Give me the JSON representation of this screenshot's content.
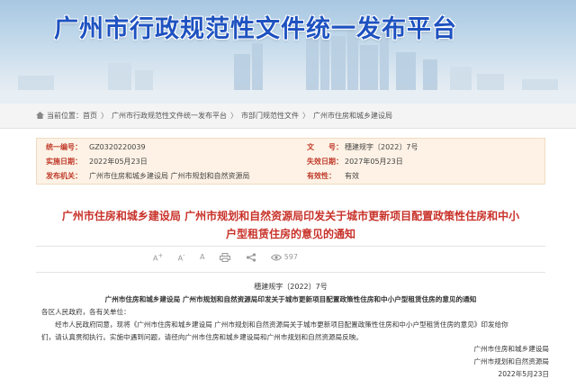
{
  "banner": {
    "title": "广州市行政规范性文件统一发布平台"
  },
  "breadcrumb": {
    "prefix": "当前位置：",
    "items": [
      "首页",
      "广州市行政规范性文件统一发布平台",
      "市部门规范性文件",
      "广州市住房和城乡建设局"
    ]
  },
  "meta": {
    "uid_label": "统一编号：",
    "uid_value": "GZ0320220039",
    "doc_label": "文　　号：",
    "doc_value": "穗建规字〔2022〕7号",
    "effective_label": "实施日期：",
    "effective_value": "2022年05月23日",
    "expire_label": "失效日期：",
    "expire_value": "2027年05月23日",
    "issuer_label": "发布机关：",
    "issuer_value": "广州市住房和城乡建设局 广州市规划和自然资源局",
    "status_label": "有效性：",
    "status_value": "有效"
  },
  "document": {
    "title_line1": "广州市住房和城乡建设局 广州市规划和自然资源局印发关于城市更新项目配置政策性住房和中小",
    "title_line2": "户型租赁住房的意见的通知",
    "views": "597",
    "doc_no": "穗建规字〔2022〕7号",
    "sub_title": "广州市住房和城乡建设局 广州市规划和自然资源局印发关于城市更新项目配置政策性住房和中小户型租赁住房的意见的通知",
    "salutation": "各区人民政府，各有关单位：",
    "body_line1": "　　经市人民政府同意，现将《广州市住房和城乡建设局 广州市规划和自然资源局关于城市更新项目配置政策性住房和中小户型租赁住房的意见》印发给你",
    "body_line2": "们，请认真贯彻执行。实施中遇到问题，请径向广州市住房和城乡建设局和广州市规划和自然资源局反映。",
    "signer1": "广州市住房和城乡建设局",
    "signer2": "广州市规划和自然资源局",
    "sign_date": "2022年5月23日"
  },
  "colors": {
    "brand_blue": "#1e52c0",
    "label_red": "#c03a2b",
    "title_red": "#c8322a",
    "meta_bg": "#fdf2e5"
  }
}
